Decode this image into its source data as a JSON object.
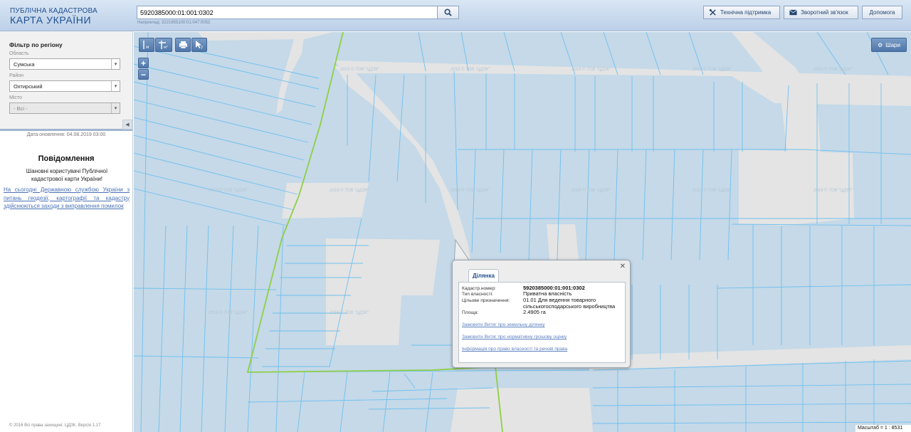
{
  "header": {
    "logo_line1": "ПУБЛІЧНА КАДАСТРОВА",
    "logo_line2": "КАРТА УКРАЇНИ",
    "search_value": "5920385000:01:001:0302",
    "search_hint": "Наприклад: 3221655100:01:047:0052",
    "support_label": "Технічна підтримка",
    "feedback_label": "Зворотний зв'язок",
    "help_label": "Допомога"
  },
  "sidebar": {
    "filter_title": "Фільтр по регіону",
    "oblast_label": "Область",
    "oblast_value": "Сумська",
    "rayon_label": "Район",
    "rayon_value": "Охтирський",
    "misto_label": "Місто",
    "misto_value": "- Всі -",
    "update_date": "Дата оновлення: 04.08.2019 03:00",
    "notice_title": "Повідомлення",
    "notice_greeting": "Шановні користувачі Публічної кадастрової карти України!",
    "notice_link": "На сьогодні Державною службою України з питань геодезії, картографії та кадастру здійснюються заходи з виправлення помилок",
    "copyright": "© 2016 Всі права захищені. ЦДЗК. Версія 1.17."
  },
  "map": {
    "layers_label": "Шари",
    "watermark_text": "2019 © ТОВ \"ЦДЗК\"",
    "scale_text": "Масштаб = 1 : 8531"
  },
  "popup": {
    "tab_label": "Ділянка",
    "rows": [
      {
        "label": "Кадастр.номер:",
        "value": "5920385000:01:001:0302"
      },
      {
        "label": "Тип власності:",
        "value": "Приватна власність"
      },
      {
        "label": "Цільове призначення:",
        "value": "01.01 Для ведення товарного сільськогосподарського виробництва"
      },
      {
        "label": "Площа:",
        "value": "2.4905 га"
      }
    ],
    "links": [
      "Замовити Витяг про земельну ділянку",
      "Замовити Витяг про нормативну грошову оцінку",
      "Інформація про право власності та речові права"
    ]
  },
  "colors": {
    "parcel_fill": "#c5d9e8",
    "parcel_line": "#6fc0ef",
    "road_fill": "#e4e4e4",
    "boundary_green": "#8fcf45",
    "header_bg": "#c9daee"
  }
}
